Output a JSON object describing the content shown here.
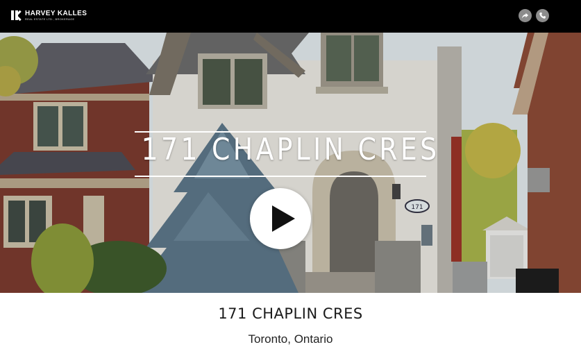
{
  "brand": {
    "name": "HARVEY KALLES",
    "sub": "REAL ESTATE LTD., BROKERAGE"
  },
  "header": {
    "icons": [
      "share-icon",
      "phone-icon"
    ],
    "icon_bg": "#8c8c8c"
  },
  "hero": {
    "title": "171 CHAPLIN CRES",
    "house_number": "171",
    "play_icon": "play-icon"
  },
  "caption": {
    "title": "171 CHAPLIN CRES",
    "location": "Toronto, Ontario"
  },
  "colors": {
    "topbar": "#000000",
    "background": "#ffffff",
    "text": "#1a1a1a"
  }
}
